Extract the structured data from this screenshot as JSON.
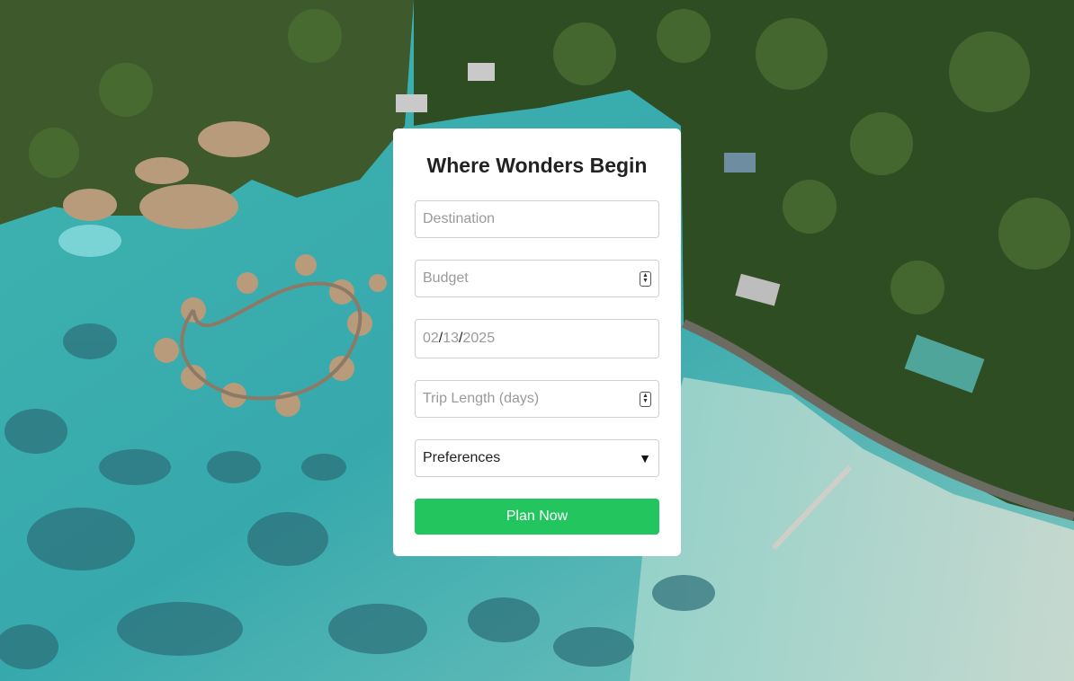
{
  "page": {
    "background_scene": "aerial-lagoon-photo"
  },
  "form": {
    "title": "Where Wonders Begin",
    "destination_placeholder": "Destination",
    "budget_placeholder": "Budget",
    "date": {
      "month": "02",
      "day": "13",
      "year": "2025",
      "separator": "/"
    },
    "trip_length_placeholder": "Trip Length (days)",
    "preferences_label": "Preferences",
    "submit_label": "Plan Now"
  },
  "colors": {
    "accent": "#22c55e",
    "card": "#ffffff",
    "title": "#222222",
    "placeholder": "#9a9a9a",
    "border": "#cfcfcf"
  },
  "icons": {
    "spinner": "number-stepper-icon",
    "select": "dropdown-arrow-icon"
  }
}
